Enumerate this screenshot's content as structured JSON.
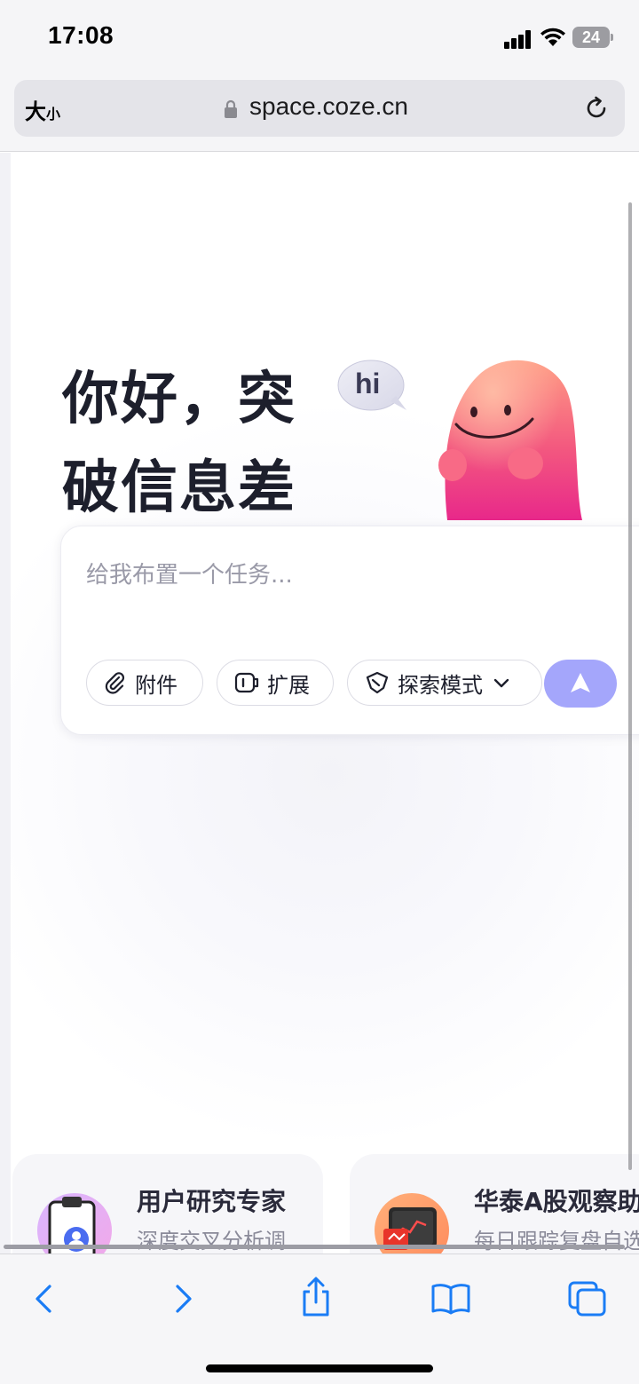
{
  "status_bar": {
    "time": "17:08",
    "battery": "24"
  },
  "browser": {
    "text_size_big": "大",
    "text_size_small": "小",
    "url": "space.coze.cn"
  },
  "hero": {
    "headline_line1": "你好，突",
    "headline_line2": "破信息差",
    "bubble_text": "hi"
  },
  "composer": {
    "placeholder": "给我布置一个任务...",
    "attach_label": "附件",
    "extend_label": "扩展",
    "mode_label": "探索模式",
    "accent_color": "#a4a6fb"
  },
  "agents": [
    {
      "title": "用户研究专家",
      "desc": "深度交叉分析调"
    },
    {
      "title": "华泰A股观察助",
      "desc": "每日跟踪复盘自选"
    }
  ],
  "toolbar": {
    "icons": [
      "back-icon",
      "forward-icon",
      "share-icon",
      "bookmarks-icon",
      "tabs-icon"
    ],
    "accent": "#1a7cf5"
  }
}
